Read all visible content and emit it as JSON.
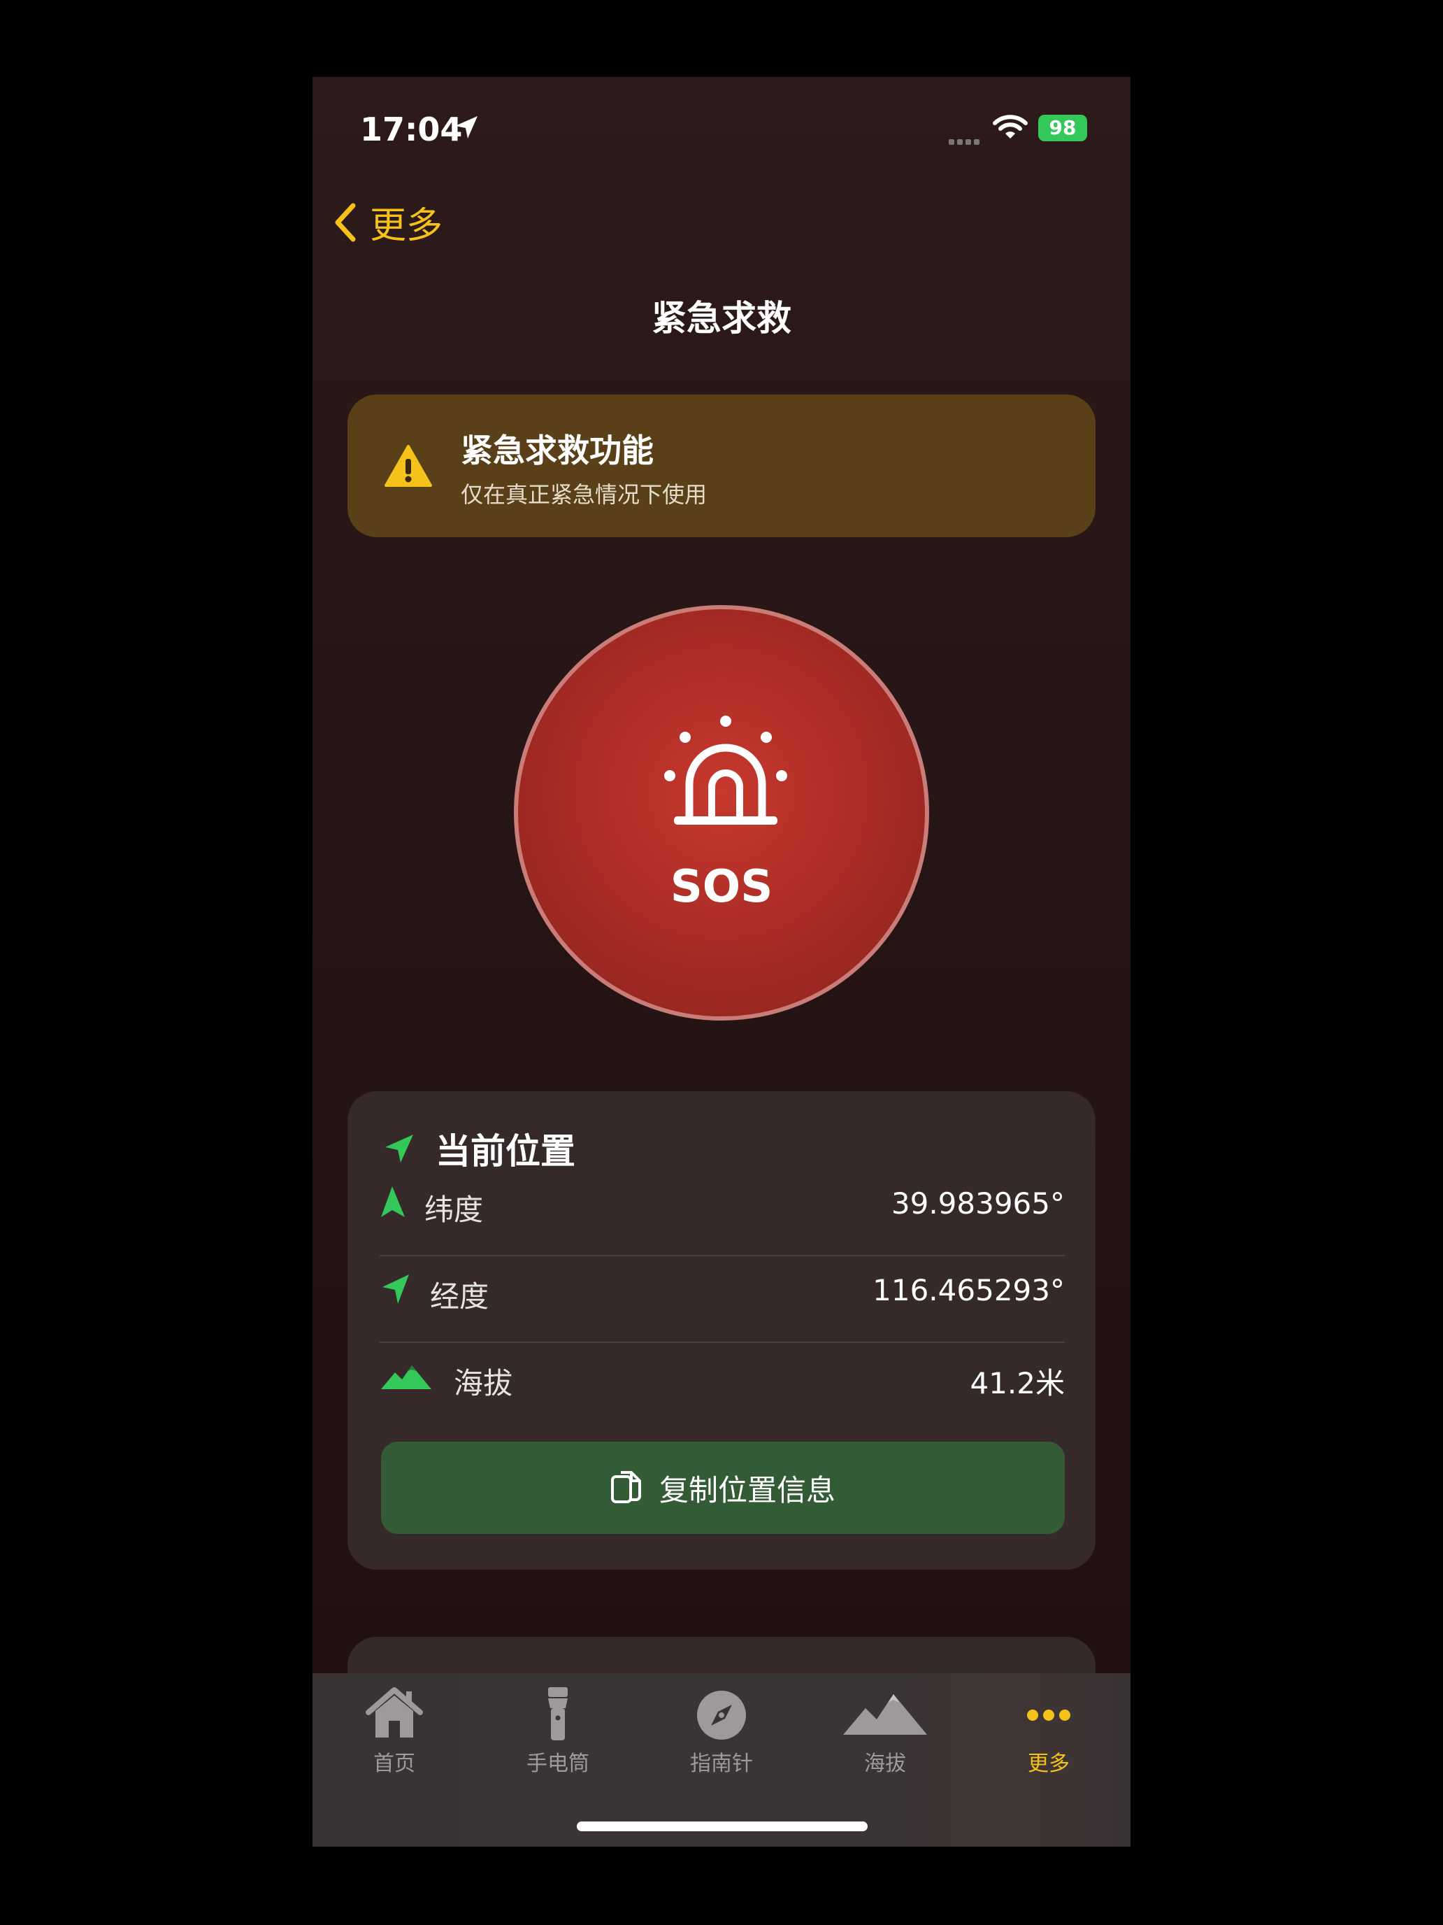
{
  "status_bar": {
    "time": "17:04",
    "battery": "98"
  },
  "nav": {
    "back_label": "更多",
    "title": "紧急求救"
  },
  "warning": {
    "title": "紧急求救功能",
    "subtitle": "仅在真正紧急情况下使用"
  },
  "sos": {
    "label": "SOS"
  },
  "location": {
    "header": "当前位置",
    "rows": [
      {
        "label": "纬度",
        "value": "39.983965°",
        "icon": "latitude-arrow-icon"
      },
      {
        "label": "经度",
        "value": "116.465293°",
        "icon": "location-arrow-icon"
      },
      {
        "label": "海拔",
        "value": "41.2米",
        "icon": "mountain-icon"
      }
    ],
    "copy_button": "复制位置信息"
  },
  "tabbar": {
    "items": [
      {
        "label": "首页",
        "icon": "house-icon",
        "active": false
      },
      {
        "label": "手电筒",
        "icon": "flashlight-icon",
        "active": false
      },
      {
        "label": "指南针",
        "icon": "compass-icon",
        "active": false
      },
      {
        "label": "海拔",
        "icon": "mountain-icon",
        "active": false
      },
      {
        "label": "更多",
        "icon": "ellipsis-icon",
        "active": true
      }
    ]
  },
  "colors": {
    "accent": "#f4c21a",
    "sos_red": "#a52b24",
    "green": "#34c759",
    "copy_green": "#335b35"
  }
}
